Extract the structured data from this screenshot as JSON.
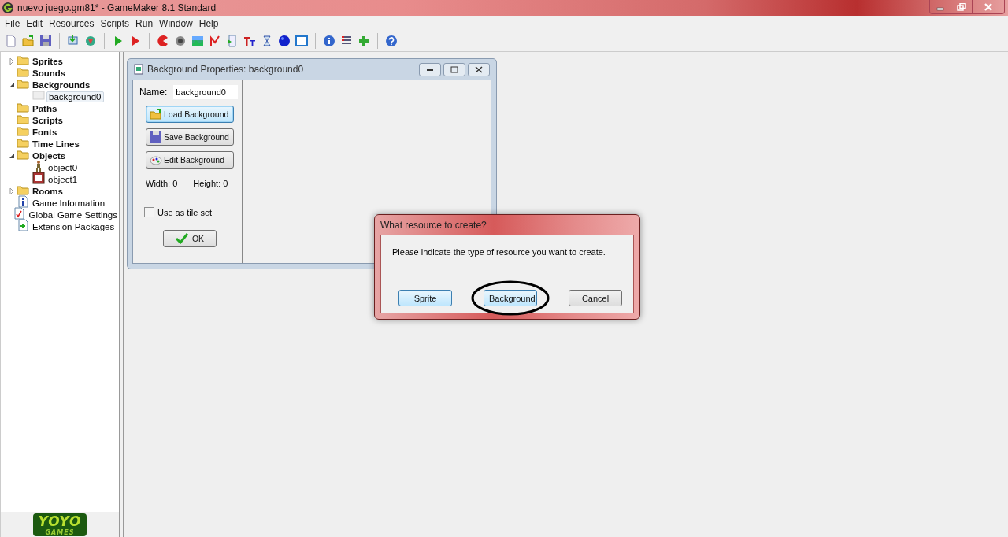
{
  "window": {
    "title": "nuevo juego.gm81* - GameMaker 8.1 Standard"
  },
  "menu": [
    "File",
    "Edit",
    "Resources",
    "Scripts",
    "Run",
    "Window",
    "Help"
  ],
  "tree": [
    {
      "label": "Sprites",
      "kind": "folder",
      "expanded": false,
      "selected": false
    },
    {
      "label": "Sounds",
      "kind": "folder",
      "selected": false
    },
    {
      "label": "Backgrounds",
      "kind": "folder",
      "expanded": true,
      "selected": false,
      "children": [
        {
          "label": "background0",
          "kind": "background",
          "selected": true
        }
      ]
    },
    {
      "label": "Paths",
      "kind": "folder",
      "selected": false
    },
    {
      "label": "Scripts",
      "kind": "folder",
      "selected": false
    },
    {
      "label": "Fonts",
      "kind": "folder",
      "selected": false
    },
    {
      "label": "Time Lines",
      "kind": "folder",
      "selected": false
    },
    {
      "label": "Objects",
      "kind": "folder",
      "expanded": true,
      "selected": false,
      "children": [
        {
          "label": "object0",
          "kind": "figure",
          "selected": false
        },
        {
          "label": "object1",
          "kind": "crate",
          "selected": false
        }
      ]
    },
    {
      "label": "Rooms",
      "kind": "folder",
      "expanded": false,
      "selected": false
    },
    {
      "label": "Game Information",
      "kind": "info",
      "selected": false
    },
    {
      "label": "Global Game Settings",
      "kind": "settings",
      "selected": false
    },
    {
      "label": "Extension Packages",
      "kind": "extension",
      "selected": false
    }
  ],
  "background_properties": {
    "title": "Background Properties: background0",
    "name_label": "Name:",
    "name_value": "background0",
    "buttons": [
      {
        "label": "Load Background",
        "kind": "load",
        "focused": true
      },
      {
        "label": "Save Background",
        "kind": "save",
        "focused": false
      },
      {
        "label": "Edit Background",
        "kind": "edit",
        "focused": false
      }
    ],
    "width_label": "Width: 0",
    "height_label": "Height: 0",
    "tile_set": {
      "label": "Use as tile set",
      "checked": false
    },
    "ok_button": "OK"
  },
  "dialog": {
    "title": "What resource to create?",
    "message": "Please indicate the type of resource you want to create.",
    "buttons": [
      {
        "label": "Sprite",
        "highlighted": true,
        "circled": false
      },
      {
        "label": "Background",
        "highlighted": true,
        "circled": true
      },
      {
        "label": "Cancel",
        "highlighted": false,
        "circled": false
      }
    ]
  },
  "logo": {
    "top": "YOYO",
    "bottom": "GAMES"
  }
}
